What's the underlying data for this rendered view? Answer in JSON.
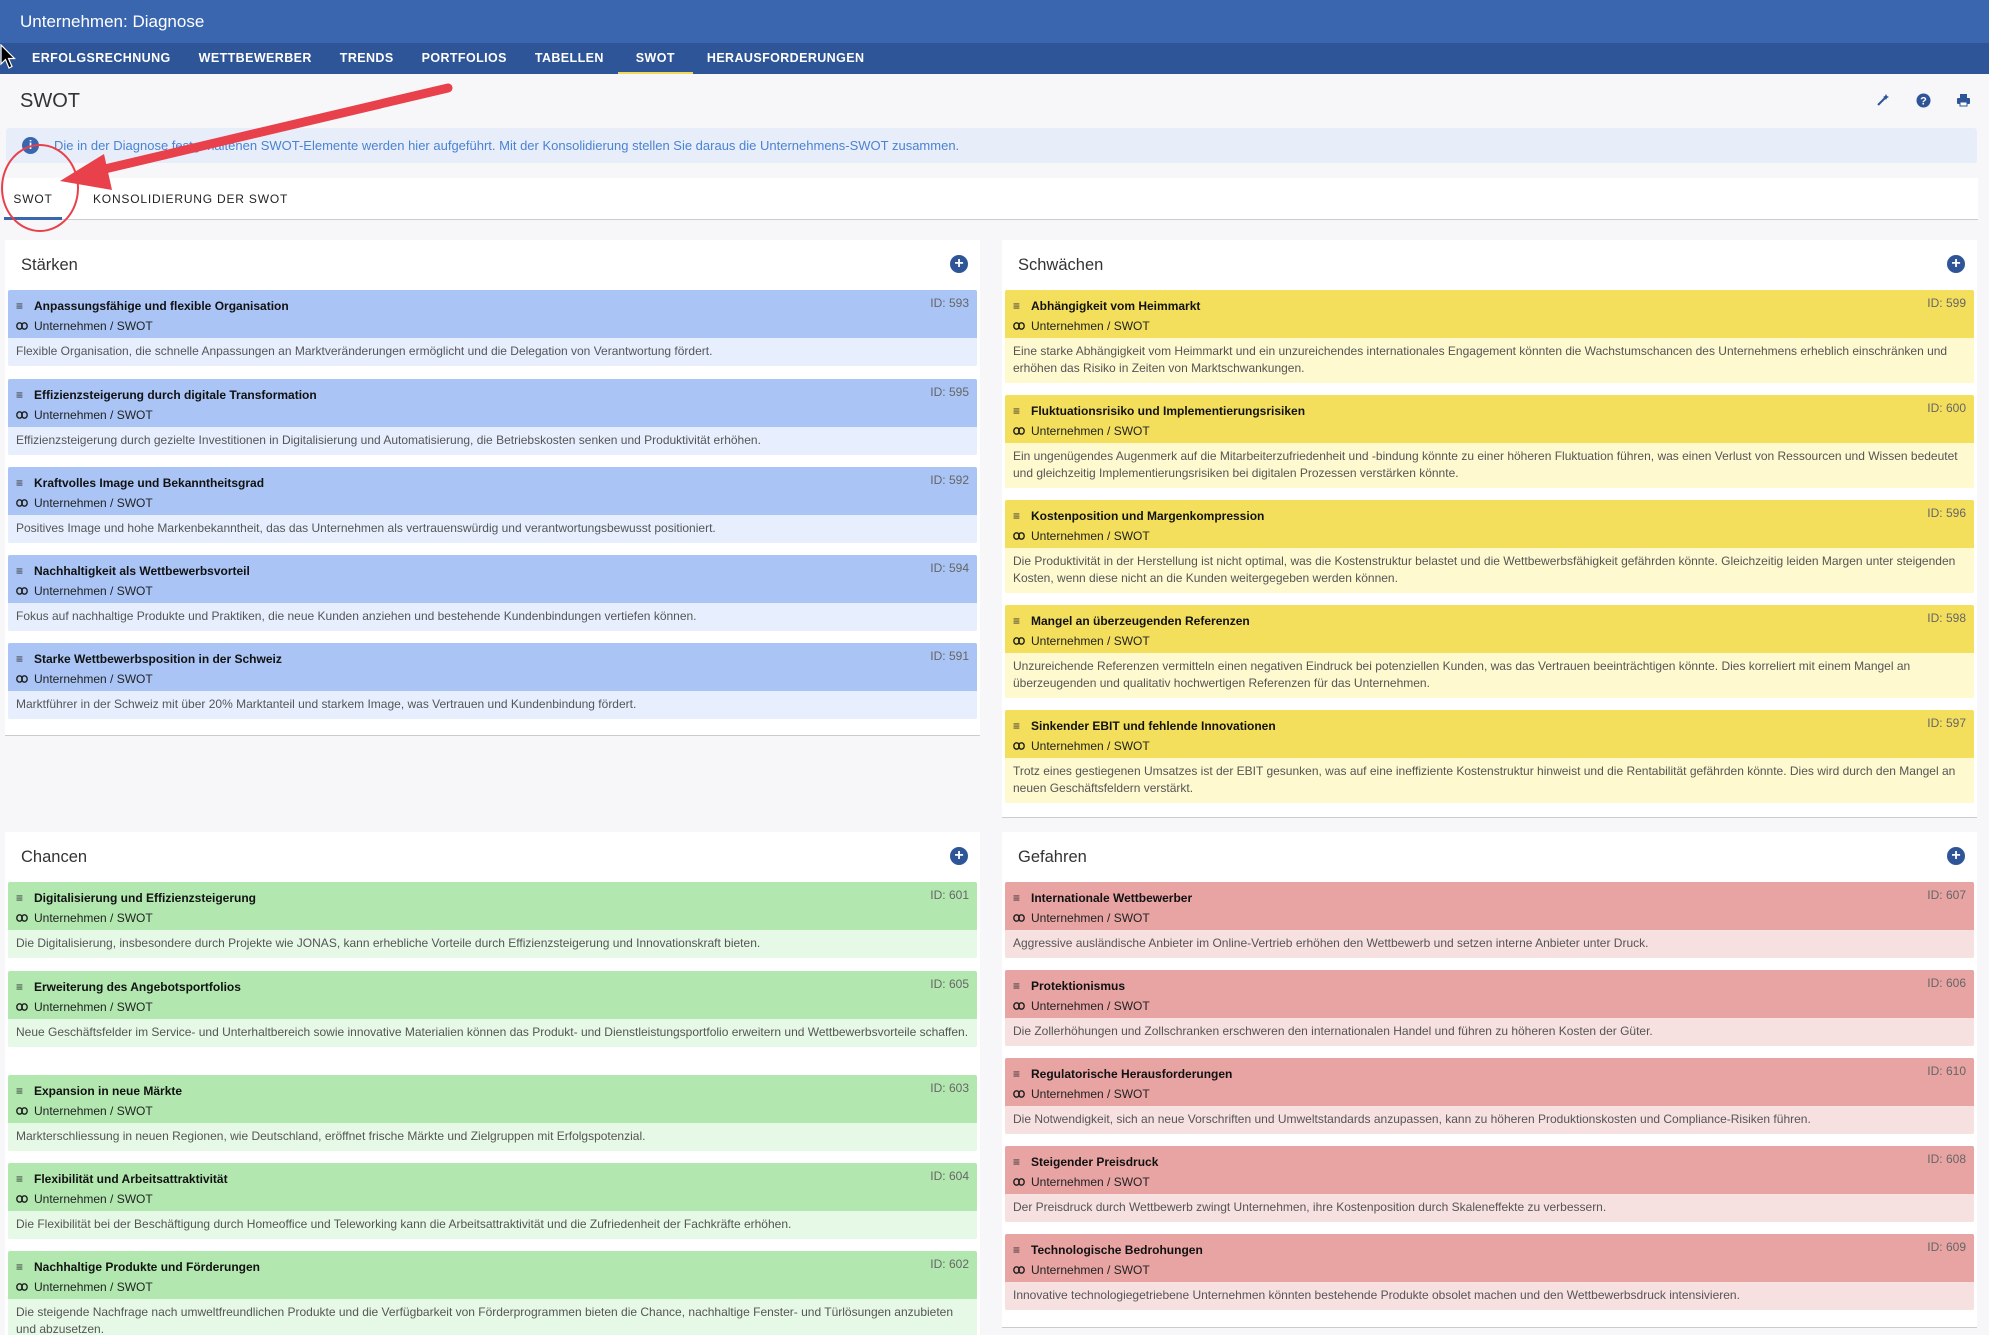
{
  "app": {
    "title": "Unternehmen: Diagnose"
  },
  "nav": [
    {
      "label": "ERFOLGSRECHNUNG"
    },
    {
      "label": "WETTBEWERBER"
    },
    {
      "label": "TRENDS"
    },
    {
      "label": "PORTFOLIOS"
    },
    {
      "label": "TABELLEN"
    },
    {
      "label": "SWOT",
      "active": true
    },
    {
      "label": "HERAUSFORDERUNGEN"
    }
  ],
  "page": {
    "title": "SWOT"
  },
  "info": {
    "text": "Die in der Diagnose festgehaltenen SWOT-Elemente werden hier aufgeführt. Mit der Konsolidierung stellen Sie daraus die Unternehmens-SWOT zusammen."
  },
  "tabs": [
    {
      "label": "SWOT",
      "active": true
    },
    {
      "label": "KONSOLIDIERUNG DER SWOT"
    }
  ],
  "colors": {
    "header": "#2d5597",
    "strengths": "#a9c4f5",
    "weaknesses": "#f4df5c",
    "opportunities": "#b2e8b0",
    "threats": "#e8a3a3",
    "annotation": "#e8414b"
  },
  "panels": {
    "strengths": {
      "title": "Stärken",
      "items": [
        {
          "title": "Anpassungsfähige und flexible Organisation",
          "path": "Unternehmen / SWOT",
          "id": "ID: 593",
          "desc": "Flexible Organisation, die schnelle Anpassungen an Marktveränderungen ermöglicht und die Delegation von Verantwortung fördert."
        },
        {
          "title": "Effizienzsteigerung durch digitale Transformation",
          "path": "Unternehmen / SWOT",
          "id": "ID: 595",
          "desc": "Effizienzsteigerung durch gezielte Investitionen in Digitalisierung und Automatisierung, die Betriebskosten senken und Produktivität erhöhen."
        },
        {
          "title": "Kraftvolles Image und Bekanntheitsgrad",
          "path": "Unternehmen / SWOT",
          "id": "ID: 592",
          "desc": "Positives Image und hohe Markenbekanntheit, das das Unternehmen als vertrauenswürdig und verantwortungsbewusst positioniert."
        },
        {
          "title": "Nachhaltigkeit als Wettbewerbsvorteil",
          "path": "Unternehmen / SWOT",
          "id": "ID: 594",
          "desc": "Fokus auf nachhaltige Produkte und Praktiken, die neue Kunden anziehen und bestehende Kundenbindungen vertiefen können."
        },
        {
          "title": "Starke Wettbewerbsposition in der Schweiz",
          "path": "Unternehmen / SWOT",
          "id": "ID: 591",
          "desc": "Marktführer in der Schweiz mit über 20% Marktanteil und starkem Image, was Vertrauen und Kundenbindung fördert."
        }
      ]
    },
    "weaknesses": {
      "title": "Schwächen",
      "items": [
        {
          "title": "Abhängigkeit vom Heimmarkt",
          "path": "Unternehmen / SWOT",
          "id": "ID: 599",
          "desc": "Eine starke Abhängigkeit vom Heimmarkt und ein unzureichendes internationales Engagement könnten die Wachstumschancen des Unternehmens erheblich einschränken und erhöhen das Risiko in Zeiten von Marktschwankungen."
        },
        {
          "title": "Fluktuationsrisiko und Implementierungsrisiken",
          "path": "Unternehmen / SWOT",
          "id": "ID: 600",
          "desc": "Ein ungenügendes Augenmerk auf die Mitarbeiterzufriedenheit und -bindung könnte zu einer höheren Fluktuation führen, was einen Verlust von Ressourcen und Wissen bedeutet und gleichzeitig Implementierungsrisiken bei digitalen Prozessen verstärken könnte."
        },
        {
          "title": "Kostenposition und Margenkompression",
          "path": "Unternehmen / SWOT",
          "id": "ID: 596",
          "desc": "Die Produktivität in der Herstellung ist nicht optimal, was die Kostenstruktur belastet und die Wettbewerbsfähigkeit gefährden könnte. Gleichzeitig leiden Margen unter steigenden Kosten, wenn diese nicht an die Kunden weitergegeben werden können."
        },
        {
          "title": "Mangel an überzeugenden Referenzen",
          "path": "Unternehmen / SWOT",
          "id": "ID: 598",
          "desc": "Unzureichende Referenzen vermitteln einen negativen Eindruck bei potenziellen Kunden, was das Vertrauen beeinträchtigen könnte. Dies korreliert mit einem Mangel an überzeugenden und qualitativ hochwertigen Referenzen für das Unternehmen."
        },
        {
          "title": "Sinkender EBIT und fehlende Innovationen",
          "path": "Unternehmen / SWOT",
          "id": "ID: 597",
          "desc": "Trotz eines gestiegenen Umsatzes ist der EBIT gesunken, was auf eine ineffiziente Kostenstruktur hinweist und die Rentabilität gefährden könnte. Dies wird durch den Mangel an neuen Geschäftsfeldern verstärkt."
        }
      ]
    },
    "opportunities": {
      "title": "Chancen",
      "items": [
        {
          "title": "Digitalisierung und Effizienzsteigerung",
          "path": "Unternehmen / SWOT",
          "id": "ID: 601",
          "desc": "Die Digitalisierung, insbesondere durch Projekte wie JONAS, kann erhebliche Vorteile durch Effizienzsteigerung und Innovationskraft bieten."
        },
        {
          "title": "Erweiterung des Angebotsportfolios",
          "path": "Unternehmen / SWOT",
          "id": "ID: 605",
          "desc": "Neue Geschäftsfelder im Service- und Unterhaltbereich sowie innovative Materialien können das Produkt- und Dienstleistungsportfolio erweitern und Wettbewerbsvorteile schaffen."
        },
        {
          "title": "Expansion in neue Märkte",
          "path": "Unternehmen / SWOT",
          "id": "ID: 603",
          "desc": "Markterschliessung in neuen Regionen, wie Deutschland, eröffnet frische Märkte und Zielgruppen mit Erfolgspotenzial."
        },
        {
          "title": "Flexibilität und Arbeitsattraktivität",
          "path": "Unternehmen / SWOT",
          "id": "ID: 604",
          "desc": "Die Flexibilität bei der Beschäftigung durch Homeoffice und Teleworking kann die Arbeitsattraktivität und die Zufriedenheit der Fachkräfte erhöhen."
        },
        {
          "title": "Nachhaltige Produkte und Förderungen",
          "path": "Unternehmen / SWOT",
          "id": "ID: 602",
          "desc": "Die steigende Nachfrage nach umweltfreundlichen Produkte und die Verfügbarkeit von Förderprogrammen bieten die Chance, nachhaltige Fenster- und Türlösungen anzubieten und abzusetzen."
        }
      ]
    },
    "threats": {
      "title": "Gefahren",
      "items": [
        {
          "title": "Internationale Wettbewerber",
          "path": "Unternehmen / SWOT",
          "id": "ID: 607",
          "desc": "Aggressive ausländische Anbieter im Online-Vertrieb erhöhen den Wettbewerb und setzen interne Anbieter unter Druck."
        },
        {
          "title": "Protektionismus",
          "path": "Unternehmen / SWOT",
          "id": "ID: 606",
          "desc": "Die Zollerhöhungen und Zollschranken erschweren den internationalen Handel und führen zu höheren Kosten der Güter."
        },
        {
          "title": "Regulatorische Herausforderungen",
          "path": "Unternehmen / SWOT",
          "id": "ID: 610",
          "desc": "Die Notwendigkeit, sich an neue Vorschriften und Umweltstandards anzupassen, kann zu höheren Produktionskosten und Compliance-Risiken führen."
        },
        {
          "title": "Steigender Preisdruck",
          "path": "Unternehmen / SWOT",
          "id": "ID: 608",
          "desc": "Der Preisdruck durch Wettbewerb zwingt Unternehmen, ihre Kostenposition durch Skaleneffekte zu verbessern."
        },
        {
          "title": "Technologische Bedrohungen",
          "path": "Unternehmen / SWOT",
          "id": "ID: 609",
          "desc": "Innovative technologiegetriebene Unternehmen könnten bestehende Produkte obsolet machen und den Wettbewerbsdruck intensivieren."
        }
      ]
    }
  }
}
